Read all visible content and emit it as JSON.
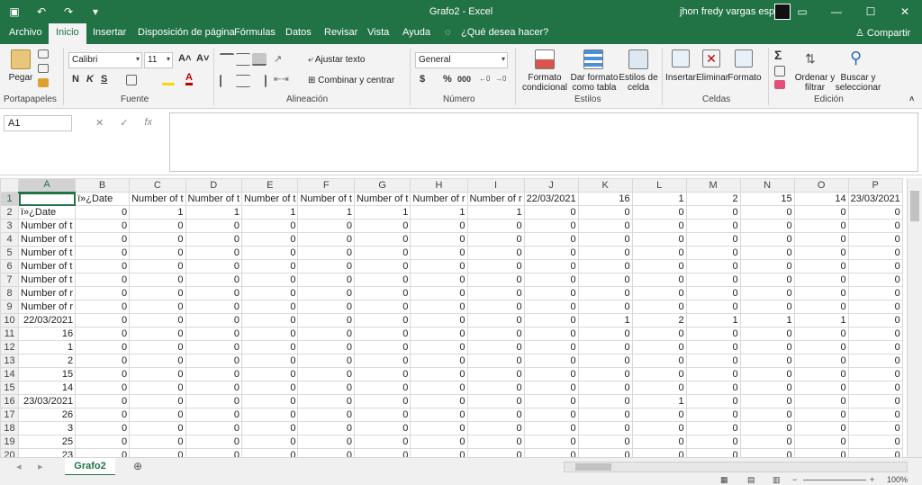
{
  "window": {
    "title": "Grafo2  -  Excel",
    "user": "jhon fredy vargas espitia"
  },
  "tabs": [
    "Archivo",
    "Inicio",
    "Insertar",
    "Disposición de página",
    "Fórmulas",
    "Datos",
    "Revisar",
    "Vista",
    "Ayuda"
  ],
  "tell_me": "¿Qué desea hacer?",
  "share": "Compartir",
  "ribbon": {
    "clipboard": {
      "paste": "Pegar",
      "label": "Portapapeles"
    },
    "font": {
      "name": "Calibri",
      "size": "11",
      "label": "Fuente",
      "bold": "N",
      "italic": "K",
      "underline": "S"
    },
    "alignment": {
      "wrap": "Ajustar texto",
      "merge": "Combinar y centrar",
      "label": "Alineación"
    },
    "number": {
      "format": "General",
      "label": "Número",
      "currency": "$",
      "percent": "%",
      "comma": "000"
    },
    "styles": {
      "conditional": "Formato condicional",
      "table": "Dar formato como tabla",
      "cell": "Estilos de celda",
      "label": "Estilos"
    },
    "cells": {
      "insert": "Insertar",
      "delete": "Eliminar",
      "format": "Formato",
      "label": "Celdas"
    },
    "editing": {
      "sort": "Ordenar y filtrar",
      "find": "Buscar y seleccionar",
      "label": "Edición"
    }
  },
  "formula_bar": {
    "name_box": "A1",
    "fx": "fx",
    "value": ""
  },
  "columns": [
    "A",
    "B",
    "C",
    "D",
    "E",
    "F",
    "G",
    "H",
    "I",
    "J",
    "K",
    "L",
    "M",
    "N",
    "O",
    "P"
  ],
  "rows": [
    [
      "",
      "ï»¿Date",
      "Number of t",
      "Number of t",
      "Number of t",
      "Number of t",
      "Number of t",
      "Number of r",
      "Number of r",
      "22/03/2021",
      "16",
      "1",
      "2",
      "15",
      "14",
      "23/03/2021"
    ],
    [
      "ï»¿Date",
      "0",
      "1",
      "1",
      "1",
      "1",
      "1",
      "1",
      "1",
      "0",
      "0",
      "0",
      "0",
      "0",
      "0",
      "0"
    ],
    [
      "Number of t",
      "0",
      "0",
      "0",
      "0",
      "0",
      "0",
      "0",
      "0",
      "0",
      "0",
      "0",
      "0",
      "0",
      "0",
      "0"
    ],
    [
      "Number of t",
      "0",
      "0",
      "0",
      "0",
      "0",
      "0",
      "0",
      "0",
      "0",
      "0",
      "0",
      "0",
      "0",
      "0",
      "0"
    ],
    [
      "Number of t",
      "0",
      "0",
      "0",
      "0",
      "0",
      "0",
      "0",
      "0",
      "0",
      "0",
      "0",
      "0",
      "0",
      "0",
      "0"
    ],
    [
      "Number of t",
      "0",
      "0",
      "0",
      "0",
      "0",
      "0",
      "0",
      "0",
      "0",
      "0",
      "0",
      "0",
      "0",
      "0",
      "0"
    ],
    [
      "Number of t",
      "0",
      "0",
      "0",
      "0",
      "0",
      "0",
      "0",
      "0",
      "0",
      "0",
      "0",
      "0",
      "0",
      "0",
      "0"
    ],
    [
      "Number of r",
      "0",
      "0",
      "0",
      "0",
      "0",
      "0",
      "0",
      "0",
      "0",
      "0",
      "0",
      "0",
      "0",
      "0",
      "0"
    ],
    [
      "Number of r",
      "0",
      "0",
      "0",
      "0",
      "0",
      "0",
      "0",
      "0",
      "0",
      "0",
      "0",
      "0",
      "0",
      "0",
      "0"
    ],
    [
      "22/03/2021",
      "0",
      "0",
      "0",
      "0",
      "0",
      "0",
      "0",
      "0",
      "0",
      "1",
      "2",
      "1",
      "1",
      "1",
      "0"
    ],
    [
      "16",
      "0",
      "0",
      "0",
      "0",
      "0",
      "0",
      "0",
      "0",
      "0",
      "0",
      "0",
      "0",
      "0",
      "0",
      "0"
    ],
    [
      "1",
      "0",
      "0",
      "0",
      "0",
      "0",
      "0",
      "0",
      "0",
      "0",
      "0",
      "0",
      "0",
      "0",
      "0",
      "0"
    ],
    [
      "2",
      "0",
      "0",
      "0",
      "0",
      "0",
      "0",
      "0",
      "0",
      "0",
      "0",
      "0",
      "0",
      "0",
      "0",
      "0"
    ],
    [
      "15",
      "0",
      "0",
      "0",
      "0",
      "0",
      "0",
      "0",
      "0",
      "0",
      "0",
      "0",
      "0",
      "0",
      "0",
      "0"
    ],
    [
      "14",
      "0",
      "0",
      "0",
      "0",
      "0",
      "0",
      "0",
      "0",
      "0",
      "0",
      "0",
      "0",
      "0",
      "0",
      "0"
    ],
    [
      "23/03/2021",
      "0",
      "0",
      "0",
      "0",
      "0",
      "0",
      "0",
      "0",
      "0",
      "0",
      "1",
      "0",
      "0",
      "0",
      "0"
    ],
    [
      "26",
      "0",
      "0",
      "0",
      "0",
      "0",
      "0",
      "0",
      "0",
      "0",
      "0",
      "0",
      "0",
      "0",
      "0",
      "0"
    ],
    [
      "3",
      "0",
      "0",
      "0",
      "0",
      "0",
      "0",
      "0",
      "0",
      "0",
      "0",
      "0",
      "0",
      "0",
      "0",
      "0"
    ],
    [
      "25",
      "0",
      "0",
      "0",
      "0",
      "0",
      "0",
      "0",
      "0",
      "0",
      "0",
      "0",
      "0",
      "0",
      "0",
      "0"
    ],
    [
      "23",
      "0",
      "0",
      "0",
      "0",
      "0",
      "0",
      "0",
      "0",
      "0",
      "0",
      "0",
      "0",
      "0",
      "0",
      "0"
    ]
  ],
  "sheet_tab": "Grafo2",
  "zoom": "100%"
}
